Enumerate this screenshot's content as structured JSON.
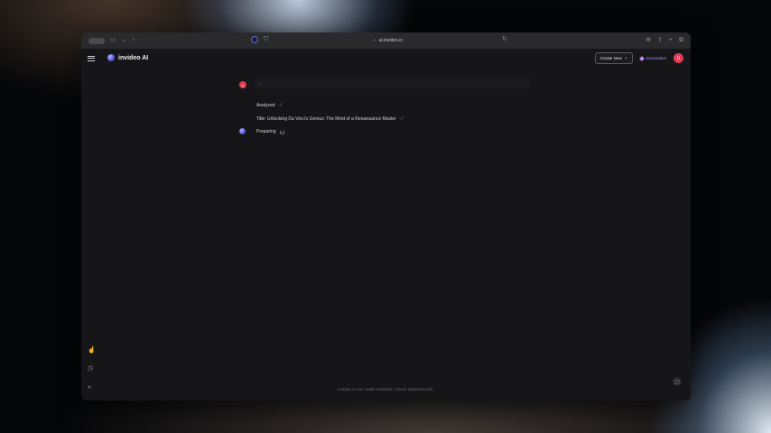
{
  "browser": {
    "url": "ai.invideo.io",
    "icons": [
      "sidebar-toggle-icon",
      "back-icon",
      "forward-icon",
      "shield-icon",
      "reload-icon",
      "download-icon",
      "share-icon",
      "new-tab-icon",
      "tabs-icon"
    ]
  },
  "header": {
    "brand": "invideo AI",
    "create_label": "Create New",
    "plan_label": "Generative",
    "avatar_initial": "U"
  },
  "chat": {
    "user_initial": "U",
    "user_message": "...",
    "steps": [
      {
        "label": "Analyzed",
        "state": "done"
      },
      {
        "label": "Title: Unlocking Da Vinci's Genius: The Mind of a Renaissance Master",
        "state": "done"
      }
    ],
    "current": {
      "label": "Preparing",
      "state": "loading"
    }
  },
  "footer": {
    "note": "invideo AI can make mistakes. Check important info."
  },
  "colors": {
    "accent": "#e23a55",
    "generative": "#b58cff",
    "background": "#161618"
  }
}
